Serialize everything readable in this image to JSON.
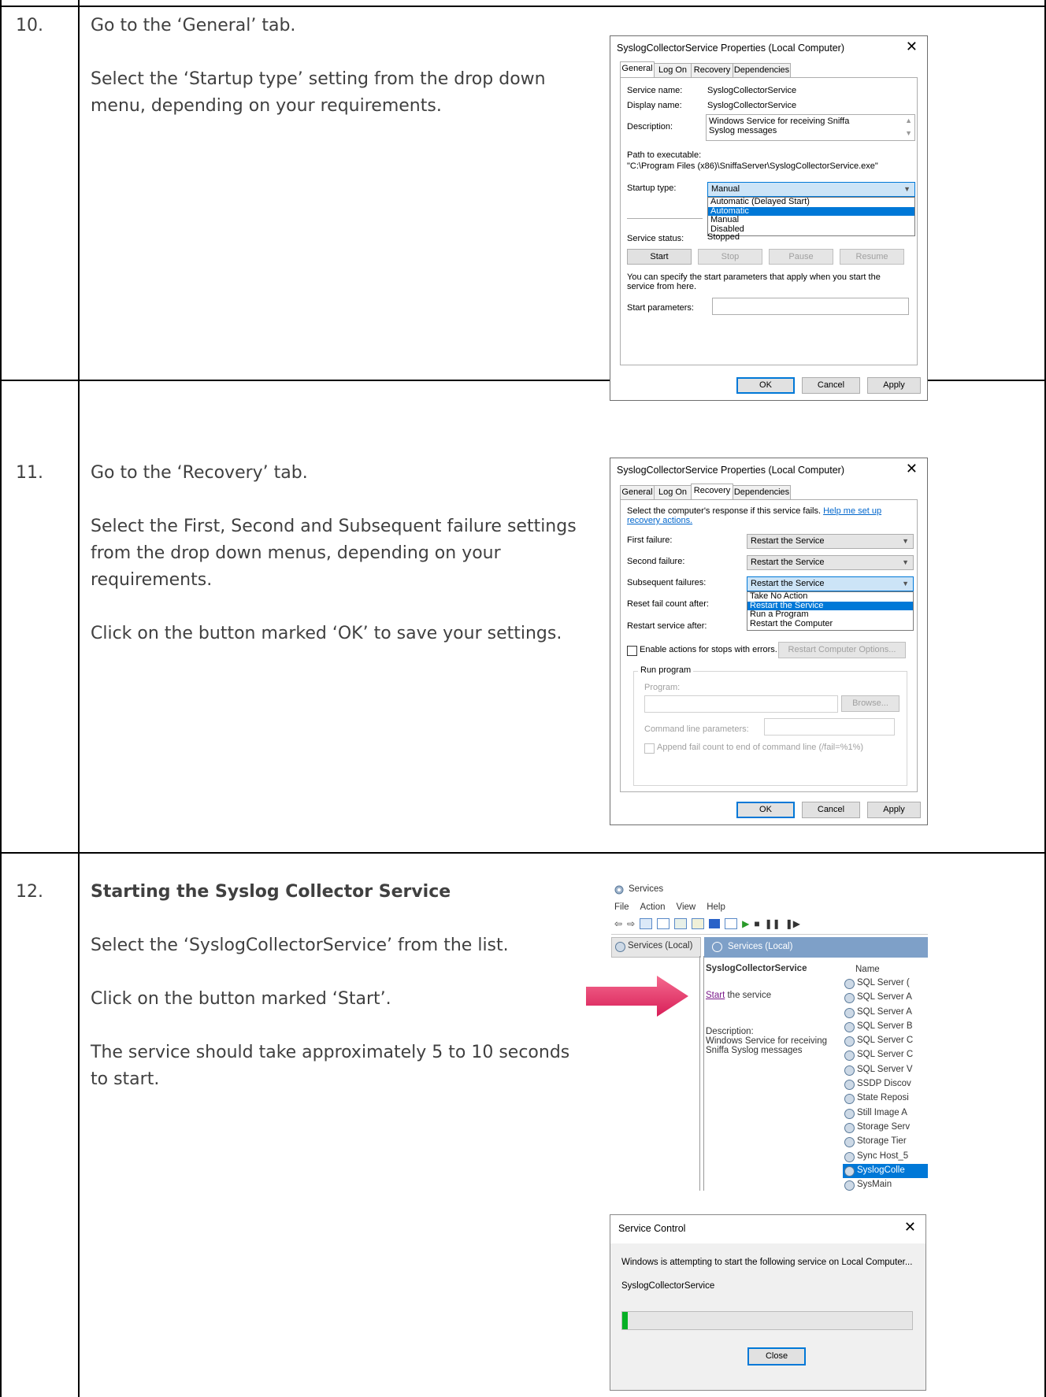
{
  "steps": [
    {
      "number": "10.",
      "paragraphs": [
        "Go to the ‘General’ tab.",
        "Select the ‘Startup type’ setting from the drop down menu, depending on your requirements."
      ]
    },
    {
      "number": "11.",
      "paragraphs": [
        "Go to the ‘Recovery’ tab.",
        "Select the First, Second and Subsequent failure settings from the drop down menus, depending on your requirements.",
        "Click on the button marked ‘OK’ to save your settings."
      ]
    },
    {
      "number": "12.",
      "heading": "Starting the Syslog Collector Service",
      "paragraphs": [
        "Select the ‘SyslogCollectorService’ from the list.",
        "Click on the button marked ‘Start’.",
        "The service should take approximately 5 to 10 seconds to start."
      ]
    }
  ],
  "dialog1": {
    "title": "SyslogCollectorService Properties (Local Computer)",
    "tabs": [
      "General",
      "Log On",
      "Recovery",
      "Dependencies"
    ],
    "service_name_label": "Service name:",
    "service_name": "SyslogCollectorService",
    "display_name_label": "Display name:",
    "display_name": "SyslogCollectorService",
    "description_label": "Description:",
    "description": "Windows Service for receiving Sniffa Syslog messages",
    "path_label": "Path to executable:",
    "path": "\"C:\\Program Files (x86)\\SniffaServer\\SyslogCollectorService.exe\"",
    "startup_label": "Startup type:",
    "startup_value": "Manual",
    "startup_options": [
      "Automatic (Delayed Start)",
      "Automatic",
      "Manual",
      "Disabled"
    ],
    "status_label": "Service status:",
    "status_value": "Stopped",
    "buttons": [
      "Start",
      "Stop",
      "Pause",
      "Resume"
    ],
    "hint": "You can specify the start parameters that apply when you start the service from here.",
    "params_label": "Start parameters:",
    "ok": "OK",
    "cancel": "Cancel",
    "apply": "Apply"
  },
  "dialog2": {
    "title": "SyslogCollectorService Properties (Local Computer)",
    "tabs": [
      "General",
      "Log On",
      "Recovery",
      "Dependencies"
    ],
    "intro": "Select the computer's response if this service fails.",
    "help_link": "Help me set up recovery actions.",
    "first_label": "First failure:",
    "first_value": "Restart the Service",
    "second_label": "Second failure:",
    "second_value": "Restart the Service",
    "subsequent_label": "Subsequent failures:",
    "subsequent_value": "Restart the Service",
    "options": [
      "Take No Action",
      "Restart the Service",
      "Run a Program",
      "Restart the Computer"
    ],
    "reset_label": "Reset fail count after:",
    "restart_label": "Restart service after:",
    "enable_actions": "Enable actions for stops with errors.",
    "restart_computer_button": "Restart Computer Options...",
    "run_program": "Run program",
    "program_label": "Program:",
    "browse": "Browse...",
    "cmd_label": "Command line parameters:",
    "append": "Append fail count to end of command line (/fail=%1%)",
    "ok": "OK",
    "cancel": "Cancel",
    "apply": "Apply"
  },
  "services": {
    "window_title": "Services",
    "menu": [
      "File",
      "Action",
      "View",
      "Help"
    ],
    "tree_item": "Services (Local)",
    "pane_header": "Services (Local)",
    "selected_service": "SyslogCollectorService",
    "start_link": "Start",
    "start_suffix": " the service",
    "desc_label": "Description:",
    "desc_text": "Windows Service for receiving Sniffa Syslog messages",
    "name_header": "Name",
    "names": [
      "SQL Server (",
      "SQL Server A",
      "SQL Server A",
      "SQL Server B",
      "SQL Server C",
      "SQL Server C",
      "SQL Server V",
      "SSDP Discov",
      "State Reposi",
      "Still Image A",
      "Storage Serv",
      "Storage Tier",
      "Sync Host_5",
      "SyslogColle",
      "SysMain"
    ]
  },
  "service_control": {
    "title": "Service Control",
    "message": "Windows is attempting to start the following service on Local Computer...",
    "service": "SyslogCollectorService",
    "progress": 0.02,
    "close": "Close"
  }
}
